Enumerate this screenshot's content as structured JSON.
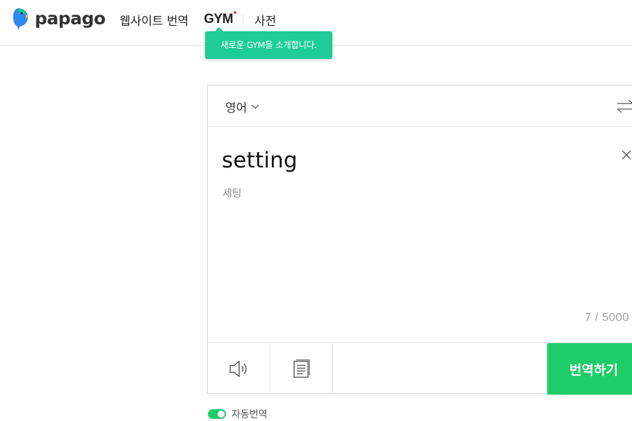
{
  "header": {
    "logo_text": "papago",
    "nav": {
      "website_translate": "웹사이트 번역",
      "gym": "GYM",
      "dictionary": "사전"
    },
    "tooltip": "새로운 GYM을 소개합니다."
  },
  "translator": {
    "source_language": "영어",
    "source_text": "setting",
    "pronunciation": "세팅",
    "char_count": "7 / 5000",
    "translate_button": "번역하기"
  },
  "footer": {
    "auto_translate_label": "자동번역"
  },
  "colors": {
    "brand_green": "#1ecd67",
    "tooltip_mint": "#1ecd96",
    "new_dot": "#ff4d2e"
  },
  "icons": [
    "papago-logo-icon",
    "chevron-down-icon",
    "swap-languages-icon",
    "close-icon",
    "speaker-icon",
    "document-icon"
  ]
}
